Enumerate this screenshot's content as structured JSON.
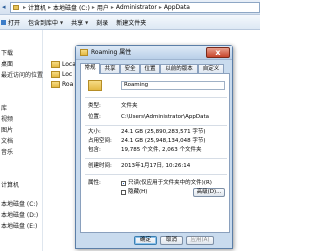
{
  "explorer": {
    "nav_arrow": "◂",
    "breadcrumb": [
      "计算机",
      "本地磁盘 (C:)",
      "用户",
      "Administrator",
      "AppData"
    ],
    "toolbar": {
      "open_label": "打开",
      "include_label": "包含到库中",
      "share_label": "共享",
      "burn_label": "刻录",
      "new_folder_label": "新建文件夹"
    },
    "sidebar_items": [
      "",
      "下载",
      "桌面",
      "最近访问的位置",
      "",
      "",
      "库",
      "视频",
      "图片",
      "文档",
      "音乐",
      "",
      "",
      "计算机",
      "本地磁盘 (C:)",
      "本地磁盘 (D:)",
      "本地磁盘 (E:)"
    ],
    "files": [
      "Local",
      "Loc",
      "Roa"
    ]
  },
  "dialog": {
    "title": "Roaming 属性",
    "close_glyph": "x",
    "tabs": [
      "常规",
      "共享",
      "安全",
      "位置",
      "以前的版本",
      "自定义"
    ],
    "active_tab": 0,
    "folder_name": "Roaming",
    "rows": [
      {
        "label": "类型:",
        "value": "文件夹"
      },
      {
        "label": "位置:",
        "value": "C:\\Users\\Administrator\\AppData"
      },
      {
        "label": "大小:",
        "value": "24.1 GB (25,890,283,571 字节)"
      },
      {
        "label": "占用空间:",
        "value": "24.1 GB (25,948,134,048 字节)"
      },
      {
        "label": "包含:",
        "value": "19,785 个文件, 2,063 个文件夹"
      },
      {
        "label": "创建时间:",
        "value": "2013年1月17日, 10:26:14"
      }
    ],
    "attributes_label": "属性:",
    "readonly_label": "只读(仅应用于文件夹中的文件)(R)",
    "hidden_label": "隐藏(H)",
    "advanced_label": "高级(D)...",
    "buttons": {
      "ok": "确定",
      "cancel": "取消",
      "apply": "应用(A)"
    },
    "colors": {
      "titlebar": "#c9dbee",
      "close_button": "#c7452c"
    }
  }
}
